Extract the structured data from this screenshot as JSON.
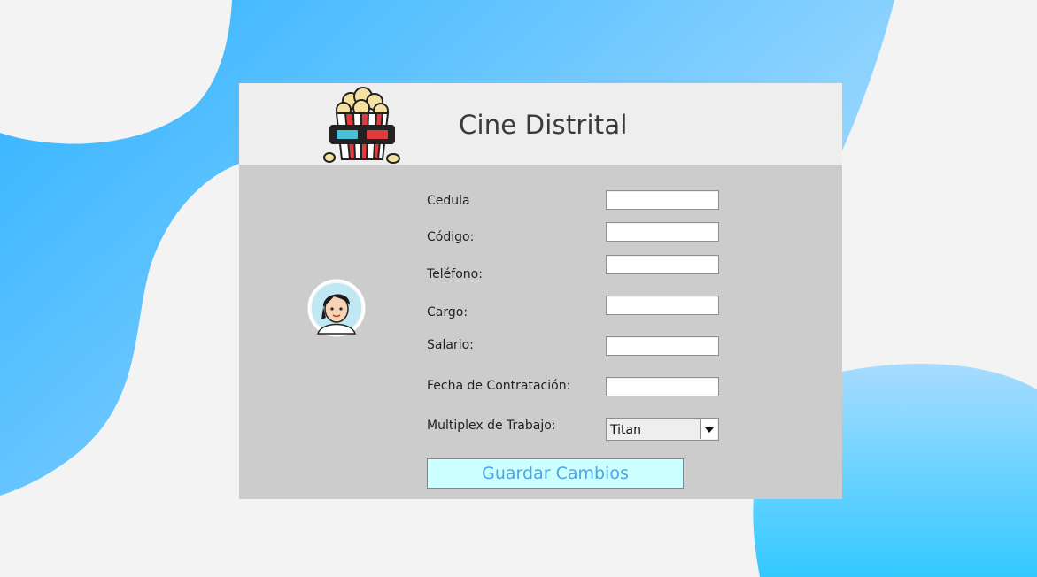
{
  "app": {
    "title": "Cine Distrital",
    "logo_icon": "popcorn-3d-glasses-icon",
    "avatar_icon": "user-avatar-icon"
  },
  "form": {
    "cedula_label": "Cedula",
    "codigo_label": "Código:",
    "telefono_label": "Teléfono:",
    "cargo_label": "Cargo:",
    "salario_label": "Salario:",
    "fecha_label": "Fecha de Contratación:",
    "multiplex_label": "Multiplex de Trabajo:",
    "cedula_value": "",
    "codigo_value": "",
    "telefono_value": "",
    "cargo_value": "",
    "salario_value": "",
    "fecha_value": "",
    "multiplex_selected": "Titan",
    "save_label": "Guardar Cambios"
  },
  "colors": {
    "background_blob": "#4cc3ff",
    "panel": "#cccccc",
    "header": "#eeeeef",
    "save_button_bg": "#ccffff",
    "save_button_text": "#4aa6e6"
  }
}
